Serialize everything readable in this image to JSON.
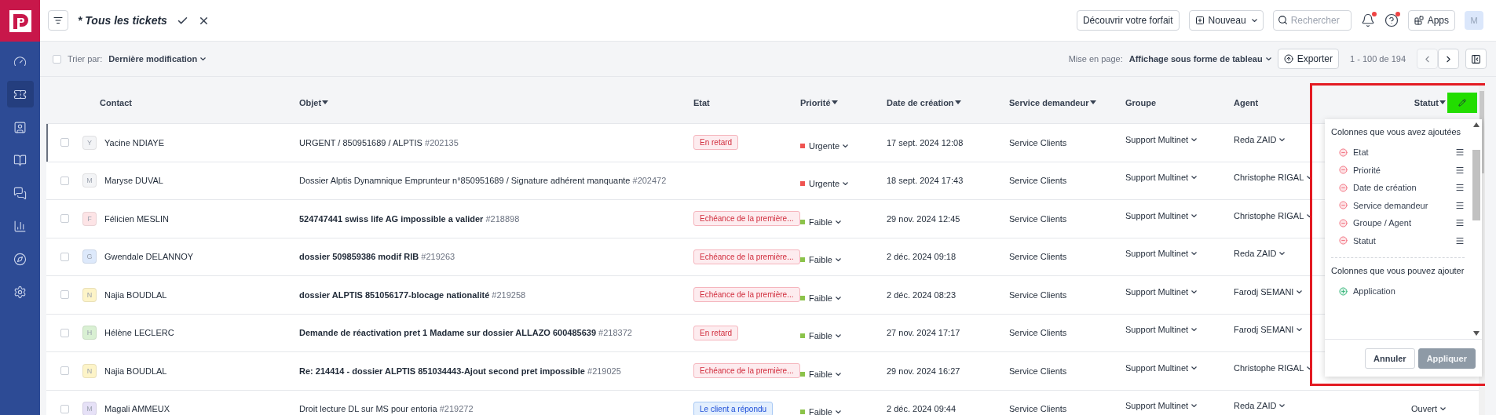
{
  "sidebar": {
    "items": [
      {
        "selected": false
      },
      {
        "selected": true
      },
      {
        "selected": false
      },
      {
        "selected": false
      },
      {
        "selected": false
      },
      {
        "selected": false
      },
      {
        "selected": false
      },
      {
        "selected": false
      }
    ]
  },
  "header": {
    "title": "* Tous les tickets",
    "plan_button": "Découvrir votre forfait",
    "new_button": "Nouveau",
    "search": {
      "placeholder": "Rechercher"
    },
    "notifications_dot": true,
    "help_dot": true,
    "apps_button": "Apps",
    "avatar": "M"
  },
  "toolbar": {
    "select_all_checked": false,
    "sort_label": "Trier par:",
    "sort_value": "Dernière modification",
    "layout_label": "Mise en page:",
    "layout_value": "Affichage sous forme de tableau",
    "export_button": "Exporter",
    "pagination": "1 - 100 de 194",
    "prev_disabled": true,
    "next_disabled": false
  },
  "table": {
    "columns": [
      {
        "label": "Contact",
        "sortable": false
      },
      {
        "label": "Objet",
        "sortable": true
      },
      {
        "label": "Etat",
        "sortable": false
      },
      {
        "label": "Priorité",
        "sortable": true
      },
      {
        "label": "Date de création",
        "sortable": true
      },
      {
        "label": "Service demandeur",
        "sortable": true
      },
      {
        "label": "Groupe",
        "sortable": false
      },
      {
        "label": "Agent",
        "sortable": false
      },
      {
        "label": "Statut",
        "sortable": true
      }
    ],
    "rows": [
      {
        "selected": true,
        "checked": false,
        "initial": "Y",
        "color": "#f3f4f6",
        "contact": "Yacine NDIAYE",
        "subject": "URGENT / 850951689 / ALPTIS",
        "unread": false,
        "ticket_id": "#202135",
        "etat": {
          "label": "En retard",
          "color": "#fdecef"
        },
        "priority": {
          "label": "Urgente",
          "color": "#ef5350"
        },
        "date": "17 sept. 2024 12:08",
        "service": "Service Clients",
        "group": "Support Multinet",
        "agent": "Reda ZAID"
      },
      {
        "selected": false,
        "checked": false,
        "initial": "M",
        "color": "#f3f4f6",
        "contact": "Maryse DUVAL",
        "subject": "Dossier Alptis Dynamnique Emprunteur n°850951689 / Signature adhérent manquante",
        "unread": false,
        "ticket_id": "#202472",
        "priority": {
          "label": "Urgente",
          "color": "#ef5350"
        },
        "date": "18 sept. 2024 17:43",
        "service": "Service Clients",
        "group": "Support Multinet",
        "agent": "Christophe RIGAL"
      },
      {
        "selected": false,
        "checked": false,
        "initial": "F",
        "color": "#fde4e6",
        "contact": "Félicien MESLIN",
        "subject": "524747441 swiss life AG impossible a valider",
        "unread": true,
        "ticket_id": "#218898",
        "etat": {
          "label": "Echéance de la première...",
          "color": "#fdecef"
        },
        "priority": {
          "label": "Faible",
          "color": "#8bc34a"
        },
        "date": "29 nov. 2024 12:45",
        "service": "Service Clients",
        "group": "Support Multinet",
        "agent": "Christophe RIGAL"
      },
      {
        "selected": false,
        "checked": false,
        "initial": "G",
        "color": "#dde9fb",
        "contact": "Gwendale DELANNOY",
        "subject": "dossier 509859386 modif RIB",
        "unread": true,
        "ticket_id": "#219263",
        "etat": {
          "label": "Echéance de la première...",
          "color": "#fdecef"
        },
        "priority": {
          "label": "Faible",
          "color": "#8bc34a"
        },
        "date": "2 déc. 2024 09:18",
        "service": "Service Clients",
        "group": "Support Multinet",
        "agent": "Reda ZAID"
      },
      {
        "selected": false,
        "checked": false,
        "initial": "N",
        "color": "#fdf4c8",
        "contact": "Najia BOUDLAL",
        "subject": "dossier ALPTIS 851056177-blocage nationalité",
        "unread": true,
        "ticket_id": "#219258",
        "etat": {
          "label": "Echéance de la première...",
          "color": "#fdecef"
        },
        "priority": {
          "label": "Faible",
          "color": "#8bc34a"
        },
        "date": "2 déc. 2024 08:23",
        "service": "Service Clients",
        "group": "Support Multinet",
        "agent": "Farodj SEMANI"
      },
      {
        "selected": false,
        "checked": false,
        "initial": "H",
        "color": "#d9f0d3",
        "contact": "Hélène LECLERC",
        "subject": "Demande de réactivation pret 1 Madame sur dossier ALLAZO 600485639",
        "unread": true,
        "ticket_id": "#218372",
        "etat": {
          "label": "En retard",
          "color": "#fdecef"
        },
        "priority": {
          "label": "Faible",
          "color": "#8bc34a"
        },
        "date": "27 nov. 2024 17:17",
        "service": "Service Clients",
        "group": "Support Multinet",
        "agent": "Farodj SEMANI"
      },
      {
        "selected": false,
        "checked": false,
        "initial": "N",
        "color": "#fdf4c8",
        "contact": "Najia BOUDLAL",
        "subject": "Re: 214414 - dossier ALPTIS 851034443-Ajout second pret impossible",
        "unread": true,
        "ticket_id": "#219025",
        "etat": {
          "label": "Echéance de la première...",
          "color": "#fdecef"
        },
        "priority": {
          "label": "Faible",
          "color": "#8bc34a"
        },
        "date": "29 nov. 2024 16:27",
        "service": "Service Clients",
        "group": "Support Multinet",
        "agent": "Christophe RIGAL"
      },
      {
        "selected": false,
        "checked": false,
        "initial": "M",
        "color": "#e6e1f7",
        "contact": "Magali AMMEUX",
        "subject": "Droit lecture DL sur MS pour entoria",
        "unread": false,
        "ticket_id": "#219272",
        "etat": {
          "label": "Le client a répondu",
          "color": "#e3effd"
        },
        "priority": {
          "label": "Faible",
          "color": "#8bc34a"
        },
        "date": "2 déc. 2024 09:44",
        "service": "Service Clients",
        "group": "Support Multinet",
        "agent": "Reda ZAID",
        "status": "Ouvert"
      }
    ]
  },
  "column_menu": {
    "added_title": "Colonnes que vous avez ajoutées",
    "added": [
      "Etat",
      "Priorité",
      "Date de création",
      "Service demandeur",
      "Groupe / Agent",
      "Statut"
    ],
    "available_title": "Colonnes que vous pouvez ajouter",
    "available": [
      "Application"
    ],
    "cancel_button": "Annuler",
    "apply_button": {
      "label": "Appliquer",
      "disabled": true
    }
  }
}
